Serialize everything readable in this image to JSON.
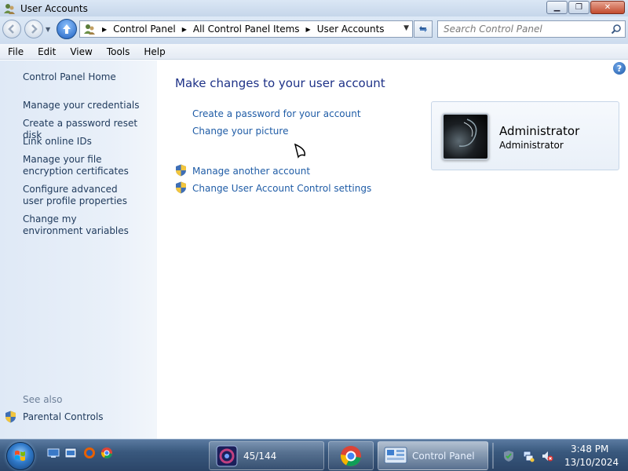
{
  "window": {
    "title": "User Accounts",
    "buttons": {
      "minimize": "▁",
      "maximize": "❐",
      "close": "✕"
    }
  },
  "address_bar": {
    "crumbs": [
      "Control Panel",
      "All Control Panel Items",
      "User Accounts"
    ],
    "search_placeholder": "Search Control Panel"
  },
  "menu": [
    "File",
    "Edit",
    "View",
    "Tools",
    "Help"
  ],
  "sidebar": {
    "home": "Control Panel Home",
    "items": [
      "Manage your credentials",
      "Create a password reset disk",
      "Link online IDs",
      "Manage your file encryption certificates",
      "Configure advanced user profile properties",
      "Change my environment variables"
    ],
    "see_also_label": "See also",
    "see_also_items": [
      "Parental Controls"
    ]
  },
  "main": {
    "title": "Make changes to your user account",
    "tasks": [
      "Create a password for your account",
      "Change your picture"
    ],
    "admin_tasks": [
      "Manage another account",
      "Change User Account Control settings"
    ]
  },
  "account": {
    "name": "Administrator",
    "role": "Administrator"
  },
  "taskbar": {
    "apps": [
      {
        "label": "45/144",
        "icon": "app-icon"
      },
      {
        "label": "",
        "icon": "chrome-icon"
      },
      {
        "label": "Control Panel",
        "icon": "control-panel-icon",
        "active": true
      }
    ],
    "clock": {
      "time": "3:48 PM",
      "date": "13/10/2024"
    }
  },
  "colors": {
    "link": "#1f5ca6",
    "title": "#1e3287",
    "sidebar_link": "#1e395b",
    "taskbar": "#39587d"
  }
}
